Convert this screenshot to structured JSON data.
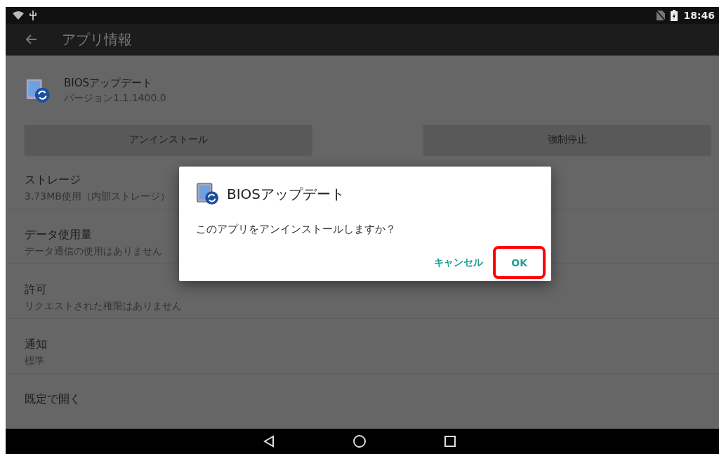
{
  "status_bar": {
    "time": "18:46"
  },
  "app_bar": {
    "title": "アプリ情報"
  },
  "app": {
    "name": "BIOSアップデート",
    "version": "バージョン1.1.1400.0"
  },
  "actions": [
    {
      "label": "アンインストール"
    },
    {
      "label": "強制停止"
    }
  ],
  "settings": [
    {
      "title": "ストレージ",
      "summary": "3.73MB使用（内部ストレージ）"
    },
    {
      "title": "データ使用量",
      "summary": "データ通信の使用はありません"
    },
    {
      "title": "許可",
      "summary": "リクエストされた権限はありません"
    },
    {
      "title": "通知",
      "summary": "標準"
    },
    {
      "title": "既定で開く"
    }
  ],
  "dialog": {
    "title": "BIOSアップデート",
    "message": "このアプリをアンインストールしますか？",
    "buttons": [
      {
        "label": "キャンセル",
        "highlighted": false
      },
      {
        "label": "OK",
        "highlighted": true
      }
    ]
  }
}
